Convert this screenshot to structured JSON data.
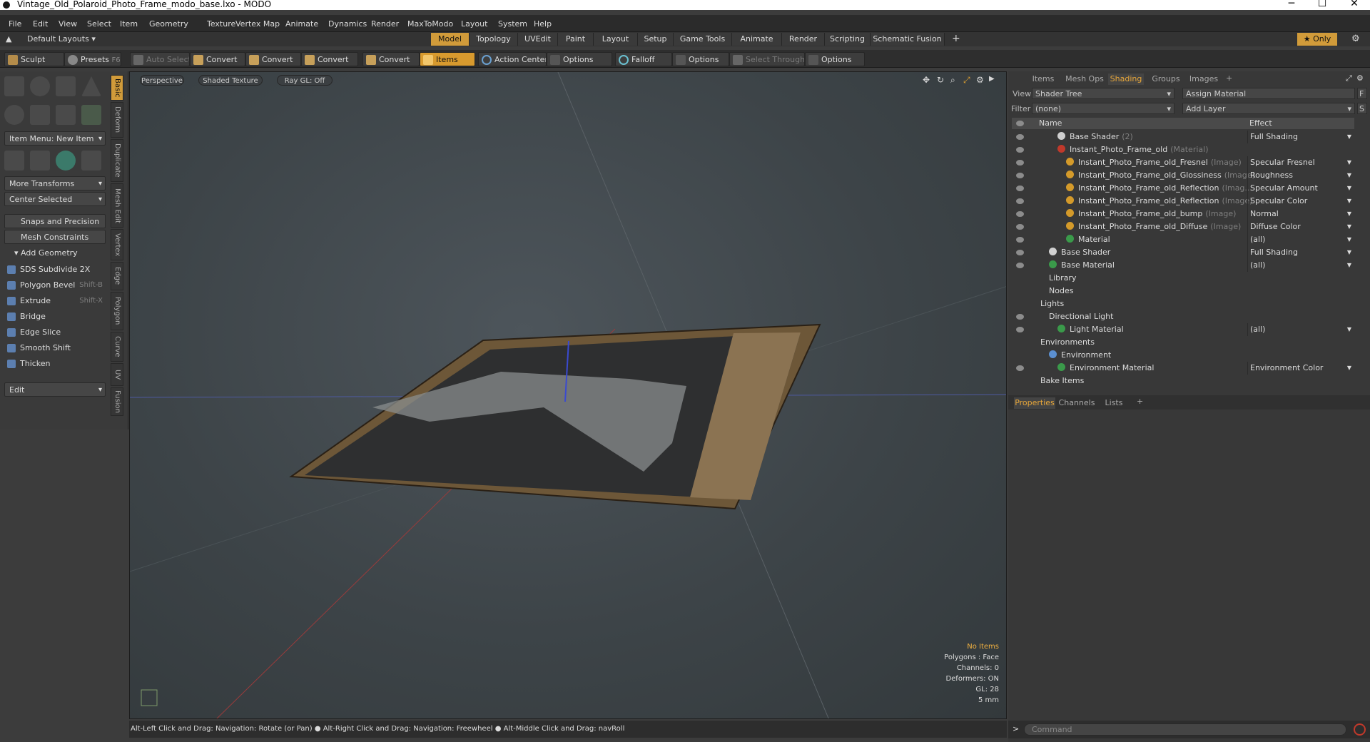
{
  "window": {
    "title": "Vintage_Old_Polaroid_Photo_Frame_modo_base.lxo - MODO"
  },
  "menu": [
    "File",
    "Edit",
    "View",
    "Select",
    "Item",
    "Geometry",
    "Texture",
    "Vertex Map",
    "Animate",
    "Dynamics",
    "Render",
    "MaxToModo",
    "Layout",
    "System",
    "Help"
  ],
  "layouts": {
    "label": "Default Layouts",
    "tabs": [
      "Model",
      "Topology",
      "UVEdit",
      "Paint",
      "Layout",
      "Setup",
      "Game Tools",
      "Animate",
      "Render",
      "Scripting",
      "Schematic Fusion"
    ],
    "active": "Model",
    "only": "Only"
  },
  "toolbar": {
    "sculpt": "Sculpt",
    "presets": "Presets",
    "presets_key": "F6",
    "auto_select": "Auto Select",
    "convert": "Convert",
    "items": "Items",
    "action_center": "Action Center",
    "options": "Options",
    "falloff": "Falloff",
    "select_through": "Select Through"
  },
  "left": {
    "item_menu": "Item Menu: New Item",
    "more_transforms": "More Transforms",
    "center_selected": "Center Selected",
    "snaps": "Snaps and Precision",
    "mesh_constraints": "Mesh Constraints",
    "add_geometry": "Add Geometry",
    "tools": [
      {
        "label": "SDS Subdivide 2X",
        "key": ""
      },
      {
        "label": "Polygon Bevel",
        "key": "Shift-B"
      },
      {
        "label": "Extrude",
        "key": "Shift-X"
      },
      {
        "label": "Bridge",
        "key": ""
      },
      {
        "label": "Edge Slice",
        "key": ""
      },
      {
        "label": "Smooth Shift",
        "key": ""
      },
      {
        "label": "Thicken",
        "key": ""
      }
    ],
    "edit": "Edit",
    "vtabs": [
      "Basic",
      "Deform",
      "Duplicate",
      "Mesh Edit",
      "Vertex",
      "Edge",
      "Polygon",
      "Curve",
      "UV",
      "Fusion"
    ]
  },
  "viewport": {
    "perspective": "Perspective",
    "shading": "Shaded Texture",
    "raygl": "Ray GL: Off",
    "stats": {
      "items": "No Items",
      "polygons": "Polygons : Face",
      "channels": "Channels: 0",
      "deformers": "Deformers: ON",
      "gl": "GL: 28",
      "size": "5 mm"
    }
  },
  "status": {
    "hint": "Alt-Left Click and Drag: Navigation: Rotate (or Pan) ● Alt-Right Click and Drag: Navigation: Freewheel ● Alt-Middle Click and Drag: navRoll"
  },
  "right": {
    "tabs": [
      "Items",
      "Mesh Ops",
      "Shading",
      "Groups",
      "Images"
    ],
    "active": "Shading",
    "view_label": "View",
    "view_value": "Shader Tree",
    "assign": "Assign Material",
    "filter_label": "Filter",
    "filter_value": "(none)",
    "add_layer": "Add Layer",
    "col_name": "Name",
    "col_effect": "Effect",
    "tree": [
      {
        "name": "Base Shader",
        "suffix": "(2)",
        "effect": "Full Shading",
        "indent": 3,
        "dot": "#d0d0d0",
        "eye": true
      },
      {
        "name": "Instant_Photo_Frame_old",
        "suffix": "(Material)",
        "effect": "",
        "indent": 3,
        "dot": "#c0392b",
        "eye": true
      },
      {
        "name": "Instant_Photo_Frame_old_Fresnel",
        "suffix": "(Image)",
        "effect": "Specular Fresnel",
        "indent": 4,
        "dot": "#d49a2a",
        "eye": true
      },
      {
        "name": "Instant_Photo_Frame_old_Glossiness",
        "suffix": "(Image)",
        "effect": "Roughness",
        "indent": 4,
        "dot": "#d49a2a",
        "eye": true
      },
      {
        "name": "Instant_Photo_Frame_old_Reflection",
        "suffix": "(Imag...",
        "effect": "Specular Amount",
        "indent": 4,
        "dot": "#d49a2a",
        "eye": true
      },
      {
        "name": "Instant_Photo_Frame_old_Reflection",
        "suffix": "(Image)",
        "effect": "Specular Color",
        "indent": 4,
        "dot": "#d49a2a",
        "eye": true
      },
      {
        "name": "Instant_Photo_Frame_old_bump",
        "suffix": "(Image)",
        "effect": "Normal",
        "indent": 4,
        "dot": "#d49a2a",
        "eye": true
      },
      {
        "name": "Instant_Photo_Frame_old_Diffuse",
        "suffix": "(Image)",
        "effect": "Diffuse Color",
        "indent": 4,
        "dot": "#d49a2a",
        "eye": true
      },
      {
        "name": "Material",
        "suffix": "",
        "effect": "(all)",
        "indent": 4,
        "dot": "#3a9a4a",
        "eye": true
      },
      {
        "name": "Base Shader",
        "suffix": "",
        "effect": "Full Shading",
        "indent": 2,
        "dot": "#d0d0d0",
        "eye": true
      },
      {
        "name": "Base Material",
        "suffix": "",
        "effect": "(all)",
        "indent": 2,
        "dot": "#3a9a4a",
        "eye": true
      },
      {
        "name": "Library",
        "suffix": "",
        "effect": "",
        "indent": 2,
        "dot": "",
        "eye": false
      },
      {
        "name": "Nodes",
        "suffix": "",
        "effect": "",
        "indent": 2,
        "dot": "",
        "eye": false
      },
      {
        "name": "Lights",
        "suffix": "",
        "effect": "",
        "indent": 1,
        "dot": "",
        "eye": false
      },
      {
        "name": "Directional Light",
        "suffix": "",
        "effect": "",
        "indent": 2,
        "dot": "",
        "eye": true
      },
      {
        "name": "Light Material",
        "suffix": "",
        "effect": "(all)",
        "indent": 3,
        "dot": "#3a9a4a",
        "eye": true
      },
      {
        "name": "Environments",
        "suffix": "",
        "effect": "",
        "indent": 1,
        "dot": "",
        "eye": false
      },
      {
        "name": "Environment",
        "suffix": "",
        "effect": "",
        "indent": 2,
        "dot": "#5b8fd0",
        "eye": false
      },
      {
        "name": "Environment Material",
        "suffix": "",
        "effect": "Environment Color",
        "indent": 3,
        "dot": "#3a9a4a",
        "eye": true
      },
      {
        "name": "Bake Items",
        "suffix": "",
        "effect": "",
        "indent": 1,
        "dot": "",
        "eye": false
      }
    ],
    "prop_tabs": [
      "Properties",
      "Channels",
      "Lists"
    ],
    "command": "Command"
  }
}
